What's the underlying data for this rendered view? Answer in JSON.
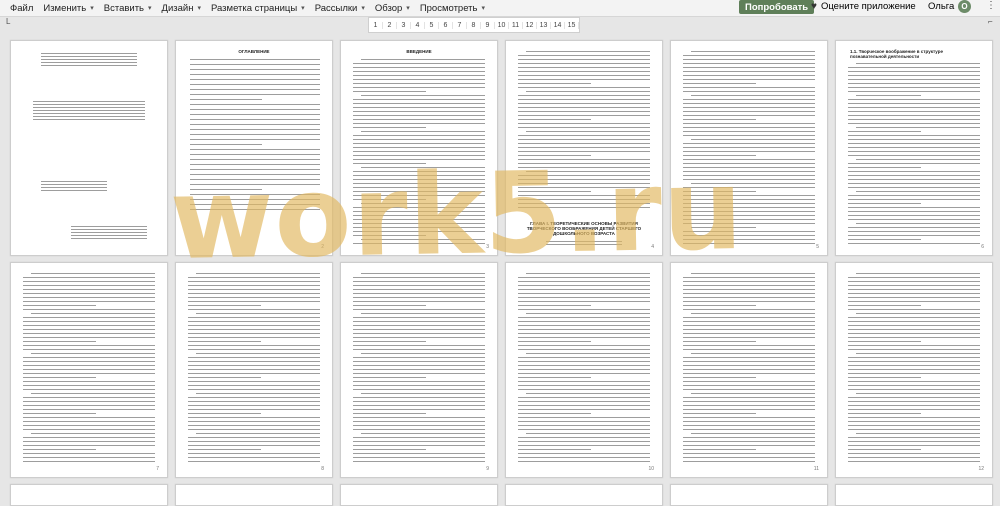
{
  "menu": {
    "items": [
      {
        "label": "Файл",
        "has_caret": false
      },
      {
        "label": "Изменить",
        "has_caret": true
      },
      {
        "label": "Вставить",
        "has_caret": true
      },
      {
        "label": "Дизайн",
        "has_caret": true
      },
      {
        "label": "Разметка страницы",
        "has_caret": true
      },
      {
        "label": "Рассылки",
        "has_caret": true
      },
      {
        "label": "Обзор",
        "has_caret": true
      },
      {
        "label": "Просмотреть",
        "has_caret": true
      }
    ],
    "caret": "▾",
    "try_button": "Попробовать",
    "rate_app": "Оцените приложение",
    "user_name": "Ольга",
    "avatar_initial": "О",
    "more_glyph": "⋮"
  },
  "ruler": {
    "left_marker": "L",
    "right_marker": "⌐",
    "ticks": [
      "1",
      "2",
      "3",
      "4",
      "5",
      "6",
      "7",
      "8",
      "9",
      "10",
      "11",
      "12",
      "13",
      "14",
      "15"
    ]
  },
  "pages_row1": [
    {
      "heading": "",
      "number": ""
    },
    {
      "heading": "ОГЛАВЛЕНИЕ",
      "number": "2"
    },
    {
      "heading": "ВВЕДЕНИЕ",
      "number": "3"
    },
    {
      "heading": "",
      "number": "4"
    },
    {
      "heading": "",
      "number": "5"
    },
    {
      "heading": "1.1. Творческое воображение в структуре познавательной деятельности",
      "number": "6"
    }
  ],
  "pages_row2": [
    {
      "number": "7"
    },
    {
      "number": "8"
    },
    {
      "number": "9"
    },
    {
      "number": "10"
    },
    {
      "number": "11"
    },
    {
      "number": "12"
    }
  ],
  "chapter_heading": "ГЛАВА I. ТЕОРЕТИЧЕСКИЕ ОСНОВЫ РАЗВИТИЯ ТВОРЧЕСКОГО ВООБРАЖЕНИЯ ДЕТЕЙ СТАРШЕГО ДОШКОЛЬНОГО ВОЗРАСТА",
  "watermark": "work5.ru",
  "colors": {
    "menubar_bg": "#f3f3f3",
    "try_button_bg": "#5f7f59",
    "workspace_bg": "#e6e6e6",
    "watermark": "#e2b862"
  }
}
